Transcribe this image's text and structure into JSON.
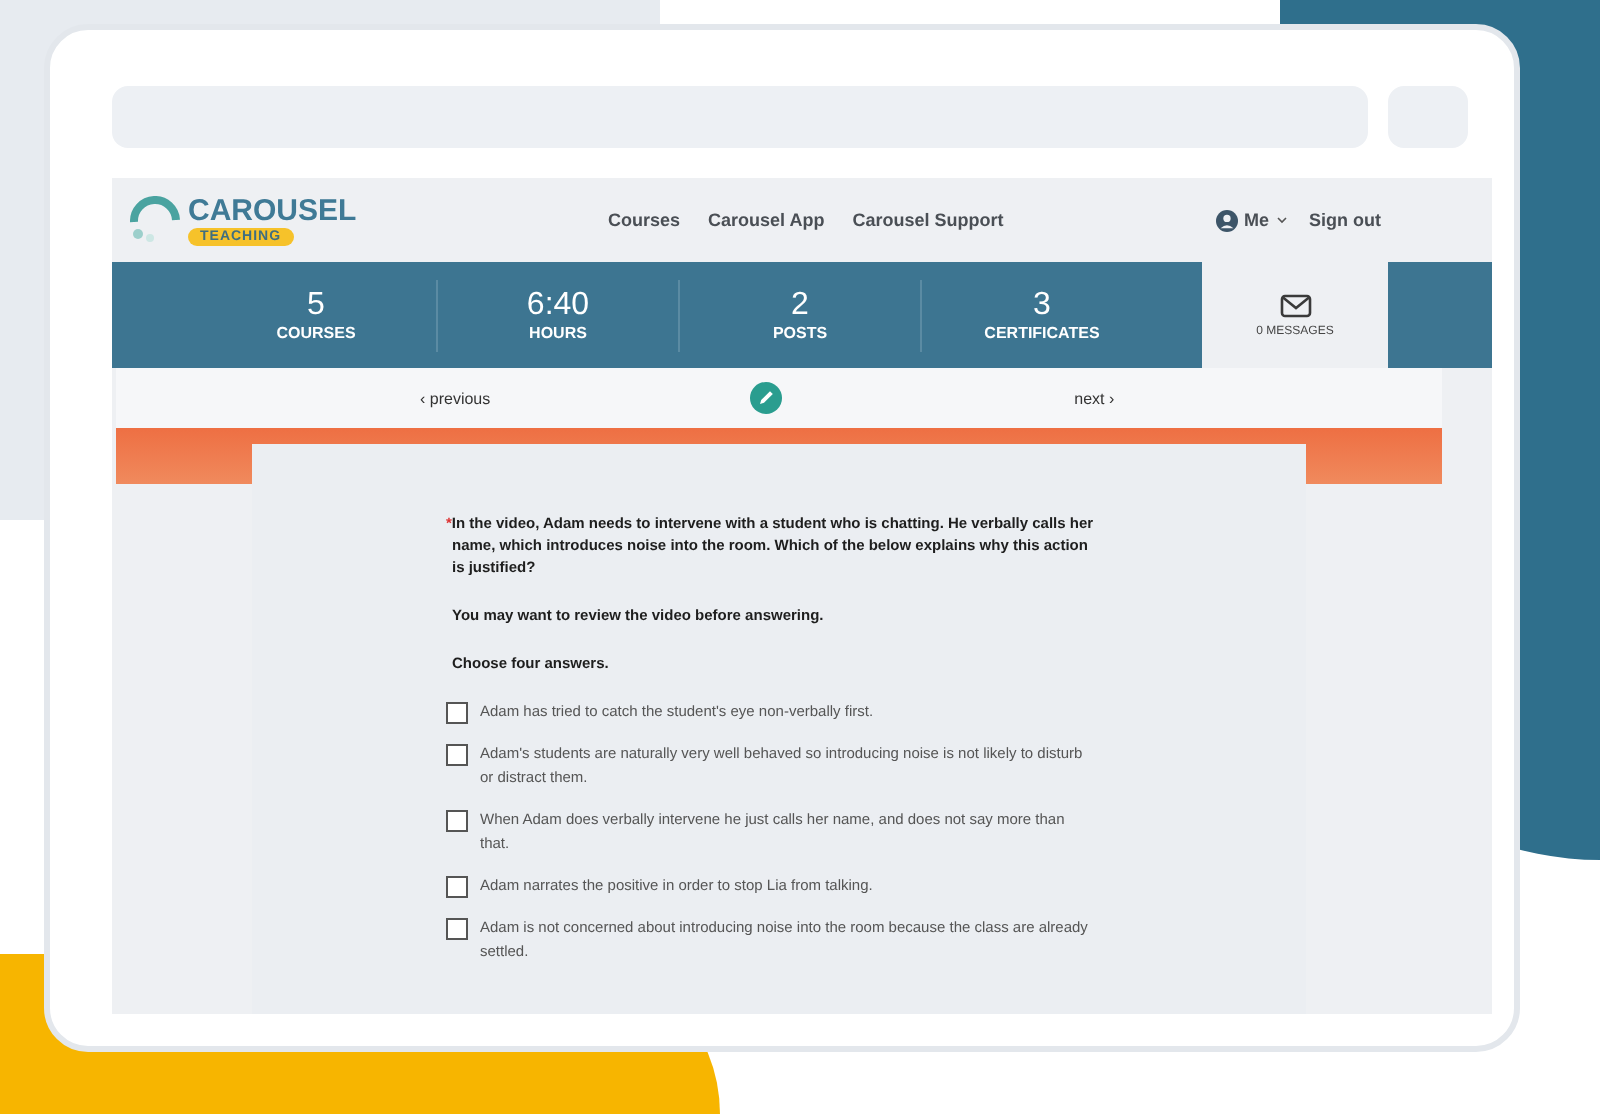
{
  "header": {
    "logo": {
      "name": "CAROUSEL",
      "tag": "TEACHING"
    },
    "nav": [
      {
        "label": "Courses"
      },
      {
        "label": "Carousel App"
      },
      {
        "label": "Carousel Support"
      }
    ],
    "user": {
      "label": "Me"
    },
    "sign_out": "Sign out"
  },
  "stats": [
    {
      "value": "5",
      "label": "COURSES"
    },
    {
      "value": "6:40",
      "label": "HOURS"
    },
    {
      "value": "2",
      "label": "POSTS"
    },
    {
      "value": "3",
      "label": "CERTIFICATES"
    }
  ],
  "messages": {
    "label": "0 MESSAGES"
  },
  "pager": {
    "previous": "‹ previous",
    "next": "next ›"
  },
  "question": {
    "required_mark": "*",
    "text": "In the video, Adam needs to intervene with a student who is chatting. He verbally calls her name, which introduces noise into the room. Which of the below explains why this action is justified?",
    "note": "You may want to review the video before answering.",
    "instruction": "Choose four answers.",
    "options": [
      {
        "text": "Adam has tried to catch the student's eye non-verbally first.",
        "checked": false
      },
      {
        "text": "Adam's students are naturally very well behaved so introducing noise is not likely to disturb or distract them.",
        "checked": false
      },
      {
        "text": "When Adam does verbally intervene he just calls her name, and does not say more than that.",
        "checked": false
      },
      {
        "text": "Adam narrates the positive in order to stop Lia from talking.",
        "checked": false
      },
      {
        "text": "Adam is not concerned about introducing noise into the room because the class are already settled.",
        "checked": false
      }
    ]
  }
}
